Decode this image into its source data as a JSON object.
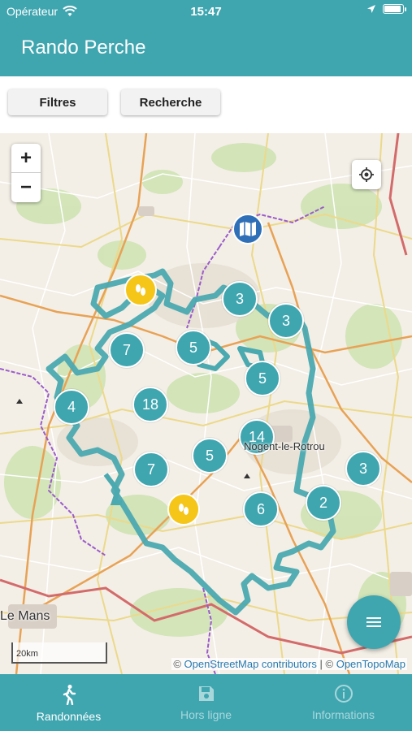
{
  "status": {
    "carrier": "Opérateur",
    "time": "15:47"
  },
  "header": {
    "title": "Rando Perche"
  },
  "toolbar": {
    "filters_label": "Filtres",
    "search_label": "Recherche"
  },
  "map": {
    "zoom_in": "+",
    "zoom_out": "−",
    "clusters": [
      "3",
      "3",
      "7",
      "5",
      "5",
      "4",
      "18",
      "14",
      "5",
      "7",
      "3",
      "6",
      "2"
    ],
    "towns": {
      "le_mans": "Le Mans",
      "nogent": "Nogent-le-Rotrou"
    },
    "scale_label": "20km",
    "attribution": {
      "prefix": "©",
      "osm": "OpenStreetMap contributors",
      "separator": "|",
      "otm": "OpenTopoMap"
    }
  },
  "tabs": [
    {
      "label": "Randonnées",
      "icon": "hiker-icon",
      "active": true
    },
    {
      "label": "Hors ligne",
      "icon": "save-icon",
      "active": false
    },
    {
      "label": "Informations",
      "icon": "info-icon",
      "active": false
    }
  ],
  "colors": {
    "accent": "#3fa6b0",
    "poi_yellow": "#f5c518",
    "poi_blue": "#2e6fb8"
  }
}
